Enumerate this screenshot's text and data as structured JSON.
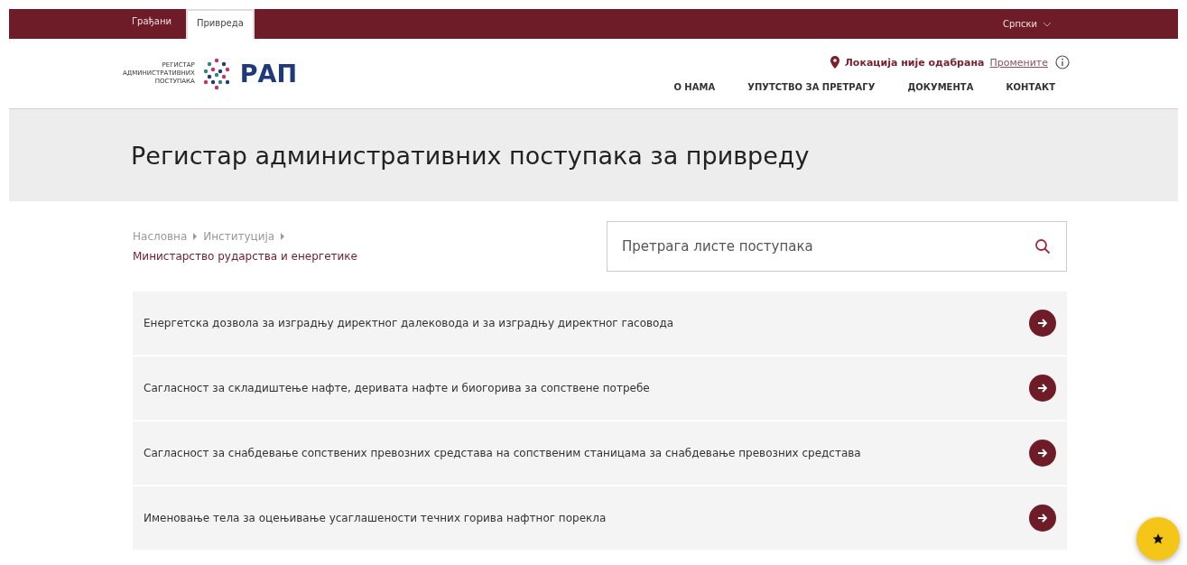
{
  "top_tabs": [
    {
      "label": "Грађани",
      "selected": false
    },
    {
      "label": "Привреда",
      "selected": true
    }
  ],
  "language": {
    "label": "Српски"
  },
  "logo": {
    "small_lines": [
      "РЕГИСТАР",
      "АДМИНИСТРАТИВНИХ",
      "ПОСТУПАКА"
    ],
    "wordmark": "РАП"
  },
  "location": {
    "text": "Локација није одабрана",
    "link": "Промените"
  },
  "nav": [
    "О НАМА",
    "УПУТСТВО ЗА ПРЕТРАГУ",
    "ДОКУМЕНТА",
    "КОНТАКТ"
  ],
  "page_title": "Регистар административних поступака за привреду",
  "breadcrumb": {
    "items": [
      "Насловна",
      "Институција"
    ],
    "current": "Министарство рударства и енергетике"
  },
  "search": {
    "placeholder": "Претрага листе поступака"
  },
  "procedures": [
    {
      "title": "Енергетска дозвола за изградњу директног далековода и за изградњу директног гасовода"
    },
    {
      "title": "Сагласност за складиштење нафте, деривата нафте и биогорива за сопствене потребе"
    },
    {
      "title": "Сагласност за снабдевање сопствених превозних средстава на сопственим станицама за снабдевање превозних средстава"
    },
    {
      "title": "Именовање тела за оцењивање усаглашености течних горива нафтног порекла"
    }
  ]
}
